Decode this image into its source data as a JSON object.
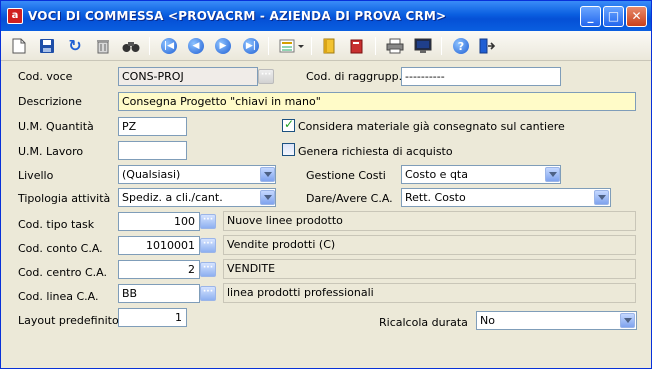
{
  "window": {
    "title": "VOCI DI COMMESSA <PROVACRM - AZIENDA DI PROVA CRM>",
    "app_icon_letter": "a",
    "minimize": "_",
    "maximize": "□",
    "close": "✕"
  },
  "toolbar": {
    "icons": [
      "new-document-icon",
      "save-icon",
      "undo-icon",
      "delete-icon",
      "find-icon",
      "first-record-icon",
      "previous-record-icon",
      "next-record-icon",
      "last-record-icon",
      "list-view-icon",
      "folder-icon",
      "archive-icon",
      "print-icon",
      "monitor-icon",
      "help-icon",
      "exit-icon"
    ]
  },
  "form": {
    "cod_voce": {
      "label": "Cod. voce",
      "value": "CONS-PROJ"
    },
    "cod_raggrupp": {
      "label": "Cod. di raggrupp.",
      "value": "----------"
    },
    "descrizione": {
      "label": "Descrizione",
      "value": "Consegna Progetto \"chiavi in mano\""
    },
    "um_quantita": {
      "label": "U.M. Quantità",
      "value": "PZ"
    },
    "um_lavoro": {
      "label": "U.M. Lavoro",
      "value": ""
    },
    "considera_materiale": {
      "label": "Considera materiale già consegnato sul cantiere",
      "checked": true
    },
    "genera_richiesta": {
      "label": "Genera richiesta di acquisto",
      "checked": false
    },
    "livello": {
      "label": "Livello",
      "value": "(Qualsiasi)"
    },
    "gestione_costi": {
      "label": "Gestione Costi",
      "value": "Costo e qta"
    },
    "tipologia_attivita": {
      "label": "Tipologia attività",
      "value": "Spediz. a cli./cant."
    },
    "dare_avere": {
      "label": "Dare/Avere C.A.",
      "value": "Rett. Costo"
    },
    "cod_tipo_task": {
      "label": "Cod. tipo task",
      "value": "100",
      "desc": "Nuove linee prodotto"
    },
    "cod_conto": {
      "label": "Cod. conto C.A.",
      "value": "1010001",
      "desc": "Vendite prodotti (C)"
    },
    "cod_centro": {
      "label": "Cod. centro C.A.",
      "value": "2",
      "desc": "VENDITE"
    },
    "cod_linea": {
      "label": "Cod. linea C.A.",
      "value": "BB",
      "desc": "linea prodotti professionali"
    },
    "layout_predefinito": {
      "label": "Layout predefinito",
      "value": "1"
    },
    "ricalcola_durata": {
      "label": "Ricalcola durata",
      "value": "No"
    },
    "lookup_glyph": "···"
  }
}
